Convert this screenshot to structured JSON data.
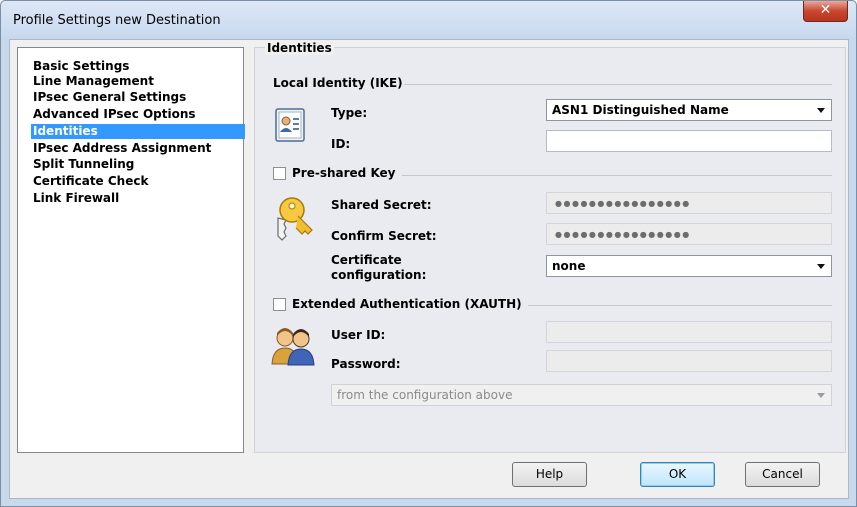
{
  "window": {
    "title": "Profile Settings   new Destination"
  },
  "nav": {
    "items": [
      {
        "label": "Basic Settings",
        "selected": false
      },
      {
        "label": "Line Management",
        "selected": false
      },
      {
        "label": "IPsec General Settings",
        "selected": false
      },
      {
        "label": "Advanced IPsec Options",
        "selected": false
      },
      {
        "label": "Identities",
        "selected": true
      },
      {
        "label": "IPsec Address Assignment",
        "selected": false
      },
      {
        "label": "Split Tunneling",
        "selected": false
      },
      {
        "label": "Certificate Check",
        "selected": false
      },
      {
        "label": "Link Firewall",
        "selected": false
      }
    ]
  },
  "panel": {
    "title": "Identities",
    "local_identity": {
      "header": "Local Identity (IKE)",
      "type_label": "Type:",
      "type_value": "ASN1 Distinguished Name",
      "id_label": "ID:",
      "id_value": ""
    },
    "psk": {
      "checkbox_label": "Pre-shared Key",
      "checked": false,
      "shared_secret_label": "Shared Secret:",
      "shared_secret_value": "●●●●●●●●●●●●●●●●",
      "confirm_secret_label": "Confirm Secret:",
      "confirm_secret_value": "●●●●●●●●●●●●●●●●",
      "cert_config_label_1": "Certificate",
      "cert_config_label_2": "configuration:",
      "cert_config_value": "none"
    },
    "xauth": {
      "checkbox_label": "Extended Authentication (XAUTH)",
      "checked": false,
      "user_id_label": "User ID:",
      "user_id_value": "",
      "password_label": "Password:",
      "password_value": "",
      "source_value": "from the configuration above"
    }
  },
  "buttons": {
    "help": "Help",
    "ok": "OK",
    "cancel": "Cancel"
  },
  "icons": [
    "id-card-icon",
    "key-icon",
    "users-icon",
    "close-icon"
  ]
}
